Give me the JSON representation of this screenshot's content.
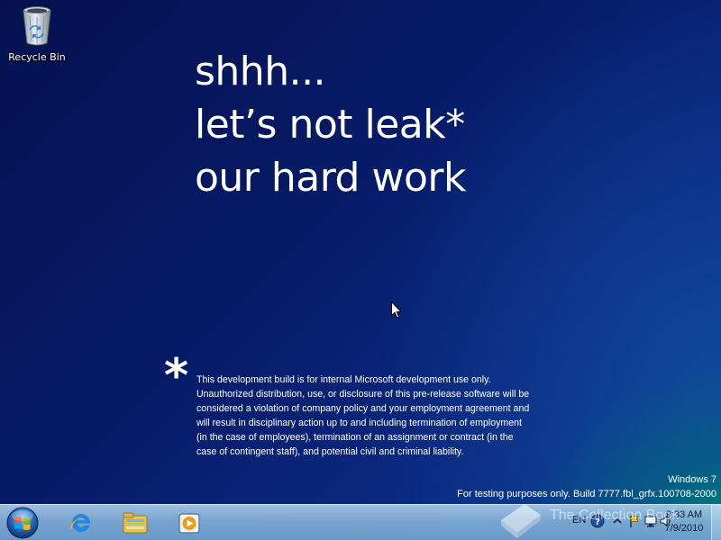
{
  "desktop": {
    "icons": [
      {
        "label": "Recycle Bin",
        "icon": "recycle-bin-icon"
      }
    ],
    "message": {
      "lines": [
        "shhh...",
        "let’s not leak*",
        "our hard work"
      ]
    },
    "disclaimer": {
      "marker": "*",
      "text": "This development build is for internal Microsoft development use only. Unauthorized distribution, use, or disclosure of this pre-release software will be considered a violation of company policy and your employment agreement and will result in disciplinary action up to and including termination of employment (in the case of employees), termination of an assignment or contract (in the case of contingent staff), and potential civil and criminal liability."
    },
    "watermark": {
      "edition": "Windows 7",
      "build": "For testing purposes only. Build 7777.fbl_grfx.100708-2000"
    },
    "overlay_watermark": "The Collection Book"
  },
  "taskbar": {
    "start_icon": "windows-start-orb-icon",
    "pinned": [
      {
        "name": "Internet Explorer",
        "icon": "internet-explorer-icon"
      },
      {
        "name": "Windows Explorer",
        "icon": "folder-library-icon"
      },
      {
        "name": "Windows Media Player",
        "icon": "media-player-icon"
      }
    ],
    "tray": {
      "language": "EN",
      "icons": [
        "help-icon",
        "show-hidden-icons-icon",
        "action-center-flag-icon",
        "network-icon",
        "volume-icon"
      ],
      "time": "9:33 AM",
      "date": "7/9/2010"
    }
  },
  "colors": {
    "desktop_dark": "#05114f",
    "desktop_teal": "#00967a",
    "taskbar": "#8fb6dc"
  }
}
